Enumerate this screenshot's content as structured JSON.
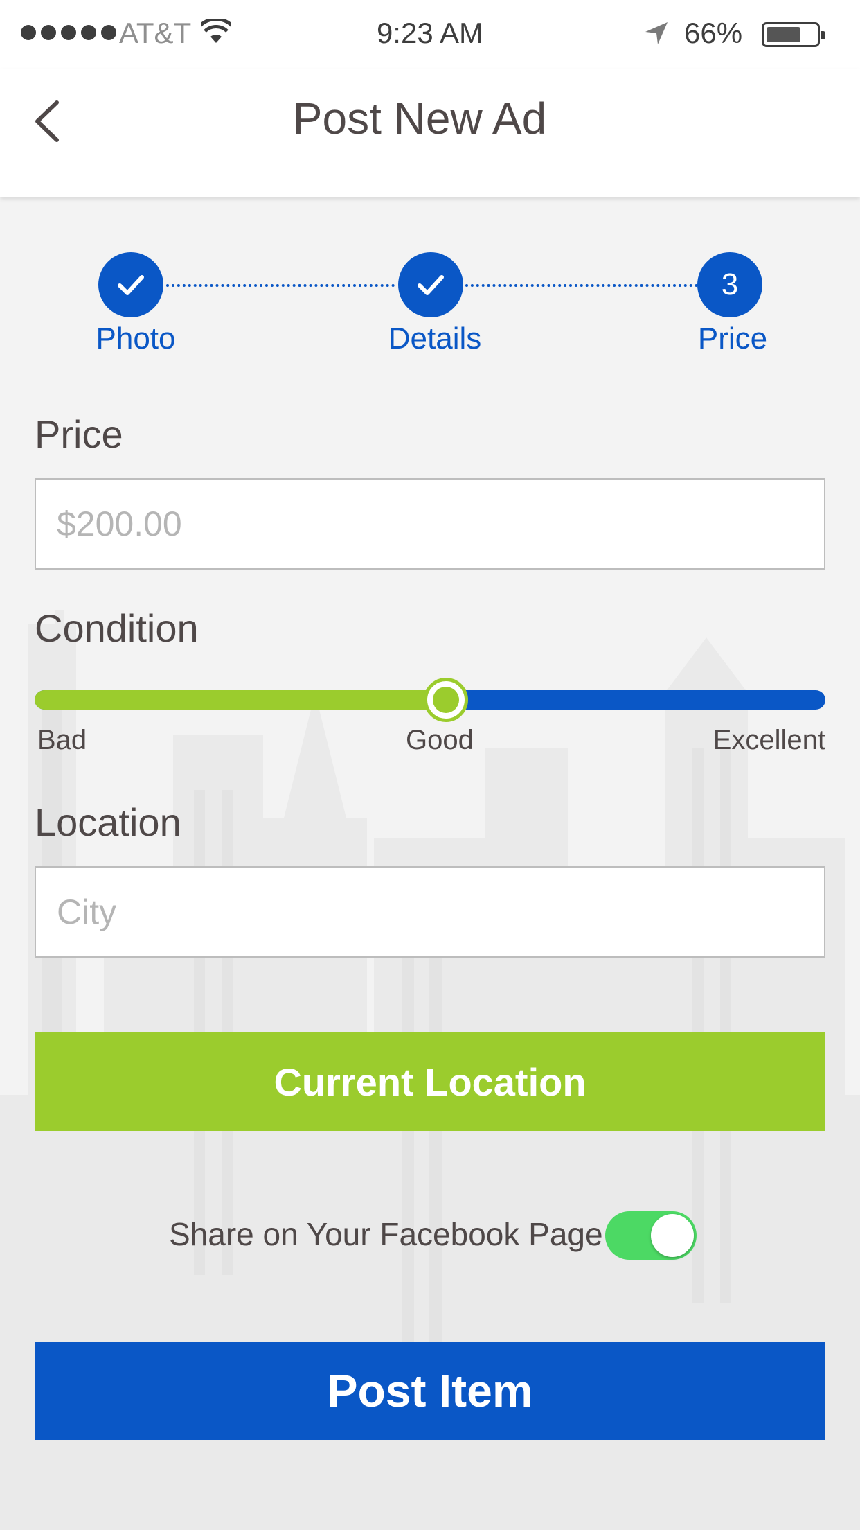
{
  "status_bar": {
    "carrier": "AT&T",
    "time": "9:23 AM",
    "battery_percent": "66%",
    "battery_level": 0.66,
    "signal_bars": 5,
    "icons": [
      "signal-dots-icon",
      "wifi-icon",
      "location-arrow-icon",
      "battery-icon"
    ]
  },
  "nav": {
    "title": "Post New Ad",
    "back_icon": "chevron-left-icon"
  },
  "stepper": {
    "steps": [
      {
        "label": "Photo",
        "state": "complete",
        "marker": ""
      },
      {
        "label": "Details",
        "state": "complete",
        "marker": ""
      },
      {
        "label": "Price",
        "state": "current",
        "marker": "3"
      }
    ]
  },
  "form": {
    "price": {
      "label": "Price",
      "value": "",
      "placeholder": "$200.00"
    },
    "condition": {
      "label": "Condition",
      "options": [
        "Bad",
        "Good",
        "Excellent"
      ],
      "selected": "Good",
      "level": 0.52
    },
    "location": {
      "label": "Location",
      "value": "",
      "placeholder": "City"
    },
    "current_location_button": "Current Location",
    "share": {
      "label": "Share on Your Facebook Page",
      "enabled": true
    },
    "post_button": "Post Item"
  },
  "colors": {
    "primary_blue": "#0a57c6",
    "accent_green": "#9bcc2d",
    "toggle_green": "#4cd964",
    "text_dark": "#4f4848",
    "background": "#f3f3f3"
  }
}
